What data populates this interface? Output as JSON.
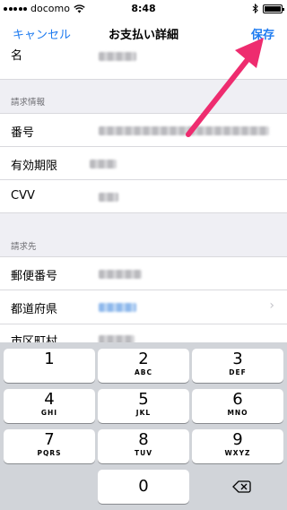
{
  "status_bar": {
    "carrier": "docomo",
    "time": "8:48"
  },
  "nav": {
    "cancel_label": "キャンセル",
    "title": "お支払い詳細",
    "save_label": "保存"
  },
  "form": {
    "top_partial_label": "名",
    "billing_info_header": "請求情報",
    "billing_rows": [
      {
        "label": "番号"
      },
      {
        "label": "有効期限"
      },
      {
        "label": "CVV"
      }
    ],
    "billing_address_header": "請求先",
    "address_rows": [
      {
        "label": "郵便番号"
      },
      {
        "label": "都道府県"
      },
      {
        "label": "市区町村"
      }
    ]
  },
  "keypad": {
    "keys": [
      {
        "num": "1",
        "letters": ""
      },
      {
        "num": "2",
        "letters": "ABC"
      },
      {
        "num": "3",
        "letters": "DEF"
      },
      {
        "num": "4",
        "letters": "GHI"
      },
      {
        "num": "5",
        "letters": "JKL"
      },
      {
        "num": "6",
        "letters": "MNO"
      },
      {
        "num": "7",
        "letters": "PQRS"
      },
      {
        "num": "8",
        "letters": "TUV"
      },
      {
        "num": "9",
        "letters": "WXYZ"
      },
      {
        "num": "0",
        "letters": ""
      }
    ]
  },
  "colors": {
    "accent": "#1e7bf0",
    "annotation_arrow": "#ee2c6f"
  },
  "icons": {
    "wifi": "wifi-icon",
    "bluetooth": "bluetooth-icon",
    "battery": "battery-icon",
    "delete": "backspace-icon",
    "chevron": "chevron-right-icon"
  }
}
